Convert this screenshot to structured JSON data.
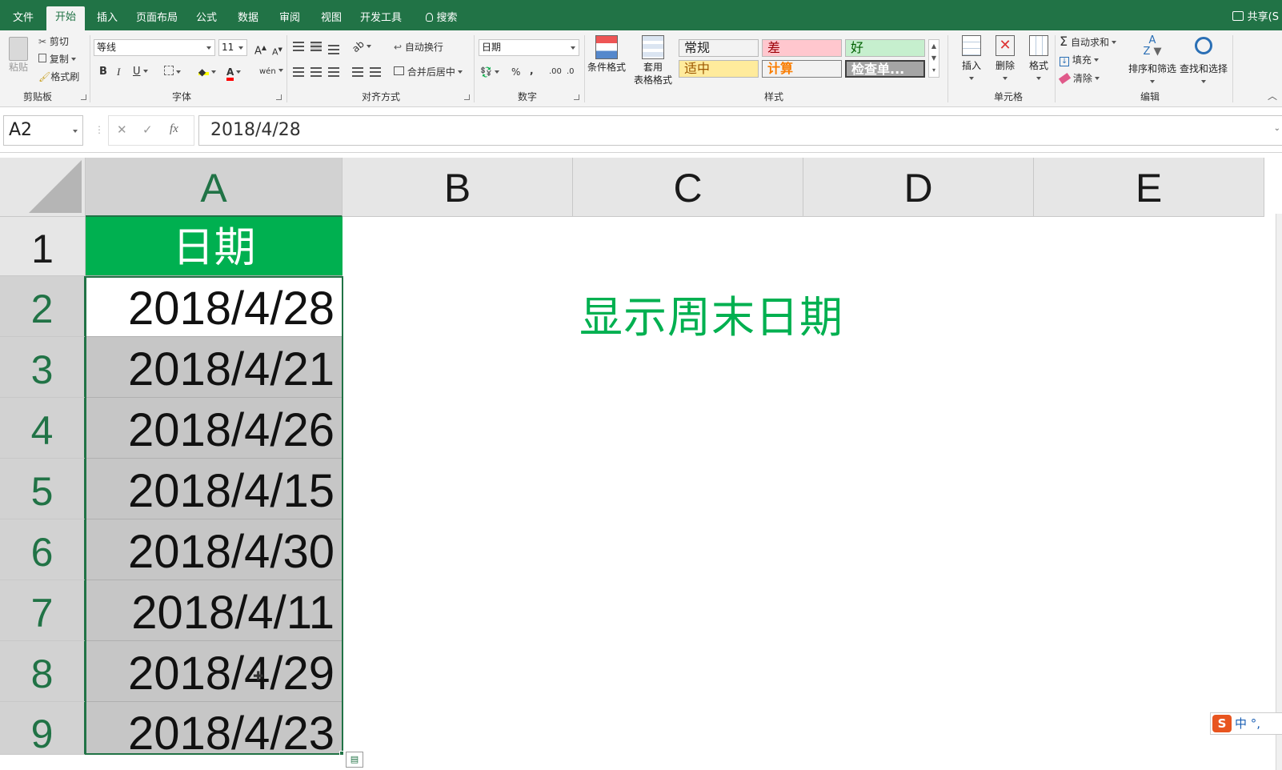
{
  "tabs": [
    {
      "label": "文件",
      "active": false
    },
    {
      "label": "开始",
      "active": true
    },
    {
      "label": "插入",
      "active": false
    },
    {
      "label": "页面布局",
      "active": false
    },
    {
      "label": "公式",
      "active": false
    },
    {
      "label": "数据",
      "active": false
    },
    {
      "label": "审阅",
      "active": false
    },
    {
      "label": "视图",
      "active": false
    },
    {
      "label": "开发工具",
      "active": false
    }
  ],
  "search_label": "搜索",
  "share_label": "共享(S",
  "ribbon": {
    "clipboard": {
      "paste": "粘贴",
      "cut": "剪切",
      "copy": "复制",
      "format_painter": "格式刷",
      "group": "剪贴板"
    },
    "font": {
      "font_name": "等线",
      "font_size": "11",
      "group": "字体"
    },
    "alignment": {
      "wrap": "自动换行",
      "merge": "合并后居中",
      "group": "对齐方式"
    },
    "number": {
      "format": "日期",
      "group": "数字"
    },
    "styles": {
      "conditional": "条件格式",
      "table_format_1": "套用",
      "table_format_2": "表格格式",
      "cells": [
        {
          "label": "常规",
          "bg": "#ffffff",
          "color": "#000000"
        },
        {
          "label": "差",
          "bg": "#ffc7ce",
          "color": "#9c0006"
        },
        {
          "label": "好",
          "bg": "#c6efce",
          "color": "#006100"
        },
        {
          "label": "适中",
          "bg": "#ffeb9c",
          "color": "#9c5700"
        },
        {
          "label": "计算",
          "bg": "#f2f2f2",
          "color": "#fa7d00"
        },
        {
          "label": "检查单...",
          "bg": "#a5a5a5",
          "color": "#ffffff"
        }
      ],
      "group": "样式"
    },
    "cells_group": {
      "insert": "插入",
      "delete": "删除",
      "format": "格式",
      "group": "单元格"
    },
    "editing": {
      "autosum": "自动求和",
      "fill": "填充",
      "clear": "清除",
      "sort": "排序和筛选",
      "find": "查找和选择",
      "group": "编辑"
    }
  },
  "formula_bar": {
    "name_box": "A2",
    "formula": "2018/4/28"
  },
  "sheet": {
    "columns": [
      "A",
      "B",
      "C",
      "D",
      "E"
    ],
    "rows": [
      "1",
      "2",
      "3",
      "4",
      "5",
      "6",
      "7",
      "8",
      "9"
    ],
    "header_cell": "日期",
    "dates": [
      "2018/4/28",
      "2018/4/21",
      "2018/4/26",
      "2018/4/15",
      "2018/4/30",
      "2018/4/11",
      "2018/4/29",
      "2018/4/23"
    ],
    "note": "显示周末日期",
    "accent": "#217346",
    "header_fill": "#00b050"
  },
  "ime": {
    "logo": "S",
    "text": "中 °,"
  }
}
